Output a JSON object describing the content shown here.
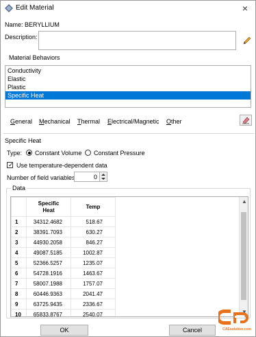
{
  "window": {
    "title": "Edit Material",
    "close": "×"
  },
  "material": {
    "name_label": "Name:",
    "name_value": "BERYLLIUM",
    "description_label": "Description:",
    "description_value": ""
  },
  "behaviors": {
    "title": "Material Behaviors",
    "items": [
      "Conductivity",
      "Elastic",
      "Plastic",
      "Specific Heat"
    ],
    "selected_index": 3,
    "menu": [
      {
        "label": "General",
        "underline": "G",
        "rest": "eneral"
      },
      {
        "label": "Mechanical",
        "underline": "M",
        "rest": "echanical"
      },
      {
        "label": "Thermal",
        "underline": "T",
        "rest": "hermal"
      },
      {
        "label": "Electrical/Magnetic",
        "underline": "E",
        "rest": "lectrical/Magnetic"
      },
      {
        "label": "Other",
        "underline": "O",
        "rest": "ther"
      }
    ]
  },
  "specific_heat": {
    "title": "Specific Heat",
    "type_label": "Type:",
    "type_options": [
      "Constant Volume",
      "Constant Pressure"
    ],
    "type_selected": "Constant Volume",
    "temp_dependent_label": "Use temperature-dependent data",
    "temp_dependent_checked": true,
    "field_vars_label": "Number of field variables:",
    "field_vars_value": "0"
  },
  "data_table": {
    "title": "Data",
    "headers": [
      "Specific\nHeat",
      "Temp"
    ],
    "rows": [
      {
        "n": "1",
        "heat": "34312.4682",
        "temp": "518.67"
      },
      {
        "n": "2",
        "heat": "38391.7093",
        "temp": "630.27"
      },
      {
        "n": "3",
        "heat": "44930.2058",
        "temp": "846.27"
      },
      {
        "n": "4",
        "heat": "49087.5185",
        "temp": "1002.87"
      },
      {
        "n": "5",
        "heat": "52366.5257",
        "temp": "1235.07"
      },
      {
        "n": "6",
        "heat": "54728.1916",
        "temp": "1463.67"
      },
      {
        "n": "7",
        "heat": "58007.1988",
        "temp": "1757.07"
      },
      {
        "n": "8",
        "heat": "60446.9363",
        "temp": "2041.47"
      },
      {
        "n": "9",
        "heat": "63725.9435",
        "temp": "2336.67"
      },
      {
        "n": "10",
        "heat": "65833.8767",
        "temp": "2540.07"
      }
    ]
  },
  "buttons": {
    "ok": "OK",
    "cancel": "Cancel"
  },
  "watermark": {
    "text": "CAEsolution.com"
  },
  "colors": {
    "selection": "#0078d7",
    "watermark": "#e8701a"
  }
}
